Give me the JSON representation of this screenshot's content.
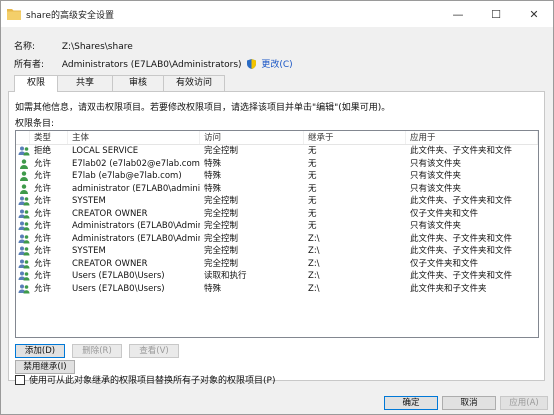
{
  "window": {
    "title": "share的高级安全设置",
    "minimize": "—",
    "maximize": "☐",
    "close": "✕"
  },
  "fields": {
    "name_label": "名称:",
    "name_value": "Z:\\Shares\\share",
    "owner_label": "所有者:",
    "owner_value": "Administrators (E7LAB0\\Administrators)",
    "change_link": "更改(C)"
  },
  "tabs": [
    {
      "label": "权限",
      "active": true
    },
    {
      "label": "共享",
      "active": false
    },
    {
      "label": "审核",
      "active": false
    },
    {
      "label": "有效访问",
      "active": false
    }
  ],
  "panel": {
    "info_text": "如需其他信息，请双击权限项目。若要修改权限项目，请选择该项目并单击\"编辑\"(如果可用)。",
    "entries_label": "权限条目:"
  },
  "table": {
    "columns": [
      "类型",
      "主体",
      "访问",
      "继承于",
      "应用于"
    ],
    "rows": [
      {
        "type": "拒绝",
        "principal": "LOCAL SERVICE",
        "access": "完全控制",
        "inherited": "无",
        "applies": "此文件夹、子文件夹和文件",
        "icon": "group"
      },
      {
        "type": "允许",
        "principal": "E7lab02 (e7lab02@e7lab.com)",
        "access": "特殊",
        "inherited": "无",
        "applies": "只有该文件夹",
        "icon": "user"
      },
      {
        "type": "允许",
        "principal": "E7lab (e7lab@e7lab.com)",
        "access": "特殊",
        "inherited": "无",
        "applies": "只有该文件夹",
        "icon": "user"
      },
      {
        "type": "允许",
        "principal": "administrator (E7LAB0\\administr...",
        "access": "特殊",
        "inherited": "无",
        "applies": "只有该文件夹",
        "icon": "user"
      },
      {
        "type": "允许",
        "principal": "SYSTEM",
        "access": "完全控制",
        "inherited": "无",
        "applies": "此文件夹、子文件夹和文件",
        "icon": "group"
      },
      {
        "type": "允许",
        "principal": "CREATOR OWNER",
        "access": "完全控制",
        "inherited": "无",
        "applies": "仅子文件夹和文件",
        "icon": "group"
      },
      {
        "type": "允许",
        "principal": "Administrators (E7LAB0\\Adminis...",
        "access": "完全控制",
        "inherited": "无",
        "applies": "只有该文件夹",
        "icon": "group"
      },
      {
        "type": "允许",
        "principal": "Administrators (E7LAB0\\Adminis...",
        "access": "完全控制",
        "inherited": "Z:\\",
        "applies": "此文件夹、子文件夹和文件",
        "icon": "group"
      },
      {
        "type": "允许",
        "principal": "SYSTEM",
        "access": "完全控制",
        "inherited": "Z:\\",
        "applies": "此文件夹、子文件夹和文件",
        "icon": "group"
      },
      {
        "type": "允许",
        "principal": "CREATOR OWNER",
        "access": "完全控制",
        "inherited": "Z:\\",
        "applies": "仅子文件夹和文件",
        "icon": "group"
      },
      {
        "type": "允许",
        "principal": "Users (E7LAB0\\Users)",
        "access": "读取和执行",
        "inherited": "Z:\\",
        "applies": "此文件夹、子文件夹和文件",
        "icon": "group"
      },
      {
        "type": "允许",
        "principal": "Users (E7LAB0\\Users)",
        "access": "特殊",
        "inherited": "Z:\\",
        "applies": "此文件夹和子文件夹",
        "icon": "group"
      }
    ]
  },
  "buttons": {
    "add": "添加(D)",
    "remove": "删除(R)",
    "view": "查看(V)",
    "disable_inheritance": "禁用继承(I)",
    "replace_checkbox": "使用可从此对象继承的权限项目替换所有子对象的权限项目(P)"
  },
  "footer": {
    "ok": "确定",
    "cancel": "取消",
    "apply": "应用(A)"
  },
  "colors": {
    "link": "#1a56c6",
    "focus_border": "#0078d7"
  }
}
